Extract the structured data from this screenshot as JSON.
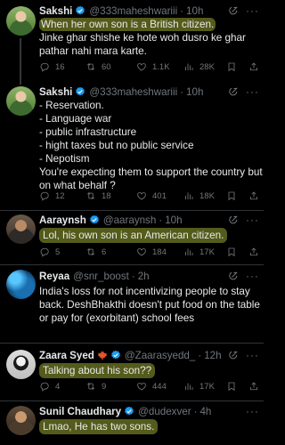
{
  "tweets": [
    {
      "name": "Sakshi",
      "handle": "@333maheshwariii",
      "time": "10h",
      "text_lines": [
        "When her own son is a British citizen.",
        "Jinke ghar shishe ke hote woh dusro ke ghar",
        "pathar nahi mara karte."
      ],
      "replies": "16",
      "reposts": "60",
      "likes": "1.1K",
      "views": "28K"
    },
    {
      "name": "Sakshi",
      "handle": "@333maheshwariii",
      "time": "10h",
      "text_lines": [
        "- Reservation.",
        "- Language war",
        "- public infrastructure",
        "- hight taxes but no public service",
        "- Nepotism",
        "You're expecting them to support the country but",
        "on what behalf ?"
      ],
      "replies": "12",
      "reposts": "18",
      "likes": "401",
      "views": "18K"
    },
    {
      "name": "Aaraynsh",
      "handle": "@aaraynsh",
      "time": "10h",
      "text_lines": [
        "Lol, his own son is an American citizen."
      ],
      "replies": "5",
      "reposts": "6",
      "likes": "184",
      "views": "17K"
    },
    {
      "name": "Reyaa",
      "handle": "@snr_boost",
      "time": "2h",
      "text_lines": [
        "India's loss for not incentivizing people to stay",
        "back. DeshBhakthi doesn't put food on the table",
        "or pay for (exorbitant)  school fees"
      ],
      "replies": "",
      "reposts": "",
      "likes": "",
      "views": ""
    },
    {
      "name": "Zaara Syed",
      "handle": "@Zaarasyedd_",
      "time": "12h",
      "text_lines": [
        "Talking about his son??"
      ],
      "replies": "4",
      "reposts": "9",
      "likes": "444",
      "views": "17K"
    },
    {
      "name": "Sunil Chaudhary",
      "handle": "@dudexver",
      "time": "4h",
      "text_lines": [
        "Lmao, He has two sons."
      ],
      "replies": "",
      "reposts": "",
      "likes": "",
      "views": ""
    }
  ],
  "more_label": "···",
  "colors": {
    "highlight": "#def046",
    "verified": "#1d9bf0",
    "muted": "#71767b"
  },
  "icons": [
    "reply-icon",
    "repost-icon",
    "like-icon",
    "views-icon",
    "bookmark-icon",
    "share-icon",
    "grok-icon",
    "verified-icon",
    "maple-leaf-icon"
  ]
}
